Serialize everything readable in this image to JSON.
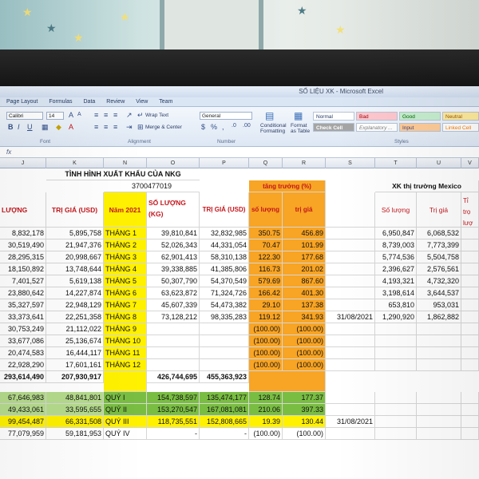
{
  "window": {
    "title": "SỐ LIỆU XK - Microsoft Excel"
  },
  "ribbon": {
    "tabs": [
      "Page Layout",
      "Formulas",
      "Data",
      "Review",
      "View",
      "Team"
    ],
    "font_name": "Calibri",
    "font_size": "14",
    "wrap_text": "Wrap Text",
    "merge_center": "Merge & Center",
    "number_format": "General",
    "conditional_formatting": "Conditional Formatting",
    "format_as_table": "Format as Table",
    "styles": {
      "normal": "Normal",
      "bad": "Bad",
      "good": "Good",
      "neutral": "Neutral",
      "check_cell": "Check Cell",
      "explanatory": "Explanatory ...",
      "input": "Input",
      "linked_cell": "Linked Cell"
    },
    "groups": {
      "font": "Font",
      "alignment": "Alignment",
      "number": "Number",
      "styles": "Styles"
    }
  },
  "columns": [
    "J",
    "K",
    "N",
    "O",
    "P",
    "Q",
    "R",
    "S",
    "T",
    "U",
    "V"
  ],
  "sheet": {
    "title": "TÌNH HÌNH XUẤT KHẨU CỦA NKG",
    "tax_code": "3700477019",
    "growth_header": "tăng trưởng (%)",
    "mexico_header": "XK thị trường Mexico",
    "headers": {
      "qty_kg": "LƯỢNG (KG)",
      "value_usd": "TRỊ GIÁ (USD)",
      "year": "Năm 2021",
      "qty2": "SỐ LƯỢNG (KG)",
      "value2": "TRỊ GIÁ (USD)",
      "growth_qty": "số lượng",
      "growth_val": "trị giá",
      "mx_qty": "Số lượng",
      "mx_val": "Trị giá",
      "mx_ratio": "Tỉ trọ lượ"
    },
    "months": [
      {
        "a": "8,832,178",
        "b": "5,895,758",
        "m": "THÁNG 1",
        "q": "39,810,841",
        "v": "32,832,985",
        "gq": "350.75",
        "gv": "456.89",
        "d": "",
        "mq": "6,950,847",
        "mv": "6,068,532"
      },
      {
        "a": "30,519,490",
        "b": "21,947,376",
        "m": "THÁNG 2",
        "q": "52,026,343",
        "v": "44,331,054",
        "gq": "70.47",
        "gv": "101.99",
        "d": "",
        "mq": "8,739,003",
        "mv": "7,773,399"
      },
      {
        "a": "28,295,315",
        "b": "20,998,667",
        "m": "THÁNG 3",
        "q": "62,901,413",
        "v": "58,310,138",
        "gq": "122.30",
        "gv": "177.68",
        "d": "",
        "mq": "5,774,536",
        "mv": "5,504,758"
      },
      {
        "a": "18,150,892",
        "b": "13,748,644",
        "m": "THÁNG 4",
        "q": "39,338,885",
        "v": "41,385,806",
        "gq": "116.73",
        "gv": "201.02",
        "d": "",
        "mq": "2,396,627",
        "mv": "2,576,561"
      },
      {
        "a": "7,401,527",
        "b": "5,619,138",
        "m": "THÁNG 5",
        "q": "50,307,790",
        "v": "54,370,549",
        "gq": "579.69",
        "gv": "867.60",
        "d": "",
        "mq": "4,193,321",
        "mv": "4,732,320"
      },
      {
        "a": "23,880,642",
        "b": "14,227,874",
        "m": "THÁNG 6",
        "q": "63,623,872",
        "v": "71,324,726",
        "gq": "166.42",
        "gv": "401.30",
        "d": "",
        "mq": "3,198,614",
        "mv": "3,644,537"
      },
      {
        "a": "35,327,597",
        "b": "22,948,129",
        "m": "THÁNG 7",
        "q": "45,607,339",
        "v": "54,473,382",
        "gq": "29.10",
        "gv": "137.38",
        "d": "",
        "mq": "653,810",
        "mv": "953,031"
      },
      {
        "a": "33,373,641",
        "b": "22,251,358",
        "m": "THÁNG 8",
        "q": "73,128,212",
        "v": "98,335,283",
        "gq": "119.12",
        "gv": "341.93",
        "d": "31/08/2021",
        "mq": "1,290,920",
        "mv": "1,862,882"
      },
      {
        "a": "30,753,249",
        "b": "21,112,022",
        "m": "THÁNG 9",
        "q": "",
        "v": "",
        "gq": "(100.00)",
        "gv": "(100.00)",
        "d": "",
        "mq": "",
        "mv": ""
      },
      {
        "a": "33,677,086",
        "b": "25,136,674",
        "m": "THÁNG 10",
        "q": "",
        "v": "",
        "gq": "(100.00)",
        "gv": "(100.00)",
        "d": "",
        "mq": "",
        "mv": ""
      },
      {
        "a": "20,474,583",
        "b": "16,444,117",
        "m": "THÁNG 11",
        "q": "",
        "v": "",
        "gq": "(100.00)",
        "gv": "(100.00)",
        "d": "",
        "mq": "",
        "mv": ""
      },
      {
        "a": "22,928,290",
        "b": "17,601,161",
        "m": "THÁNG 12",
        "q": "",
        "v": "",
        "gq": "(100.00)",
        "gv": "(100.00)",
        "d": "",
        "mq": "",
        "mv": ""
      }
    ],
    "totals": {
      "a": "293,614,490",
      "b": "207,930,917",
      "q": "426,744,695",
      "v": "455,363,923"
    },
    "quarters": [
      {
        "a": "67,646,983",
        "b": "48,841,801",
        "m": "QUÝ I",
        "q": "154,738,597",
        "v": "135,474,177",
        "gq": "128.74",
        "gv": "177.37",
        "d": "",
        "cls": "g"
      },
      {
        "a": "49,433,061",
        "b": "33,595,655",
        "m": "QUÝ II",
        "q": "153,270,547",
        "v": "167,081,081",
        "gq": "210.06",
        "gv": "397.33",
        "d": "",
        "cls": "g"
      },
      {
        "a": "99,454,487",
        "b": "66,331,508",
        "m": "QUÝ III",
        "q": "118,735,551",
        "v": "152,808,665",
        "gq": "19.39",
        "gv": "130.44",
        "d": "31/08/2021",
        "cls": "y"
      },
      {
        "a": "77,079,959",
        "b": "59,181,953",
        "m": "QUÝ IV",
        "q": "-",
        "v": "-",
        "gq": "(100.00)",
        "gv": "(100.00)",
        "d": "",
        "cls": ""
      }
    ]
  },
  "colors": {
    "yellow": "#fff100",
    "orange": "#f8a424",
    "green": "#79bd42",
    "red_text": "#c4161c"
  }
}
